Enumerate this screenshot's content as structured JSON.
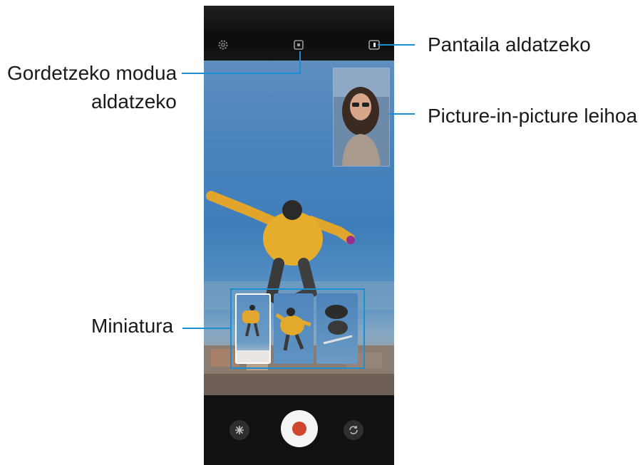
{
  "callouts": {
    "storage_mode_line1": "Gordetzeko modua",
    "storage_mode_line2": "aldatzeko",
    "switch_screen": "Pantaila aldatzeko",
    "pip_window": "Picture-in-picture leihoa",
    "thumbnail": "Miniatura"
  },
  "toolbar": {
    "settings_icon": "gear-icon",
    "storage_mode_icon": "storage-mode-icon",
    "switch_screen_icon": "switch-screen-icon"
  },
  "controls": {
    "effects_icon": "snowflake-icon",
    "record_icon": "record-icon",
    "switch_camera_icon": "switch-camera-icon"
  },
  "thumbnails": [
    "thumbnail-1",
    "thumbnail-2",
    "thumbnail-3"
  ],
  "colors": {
    "callout_line": "#1c8fd3",
    "record_red": "#d0452d",
    "sky": "#4a83bd",
    "jacket": "#e0a52a"
  }
}
